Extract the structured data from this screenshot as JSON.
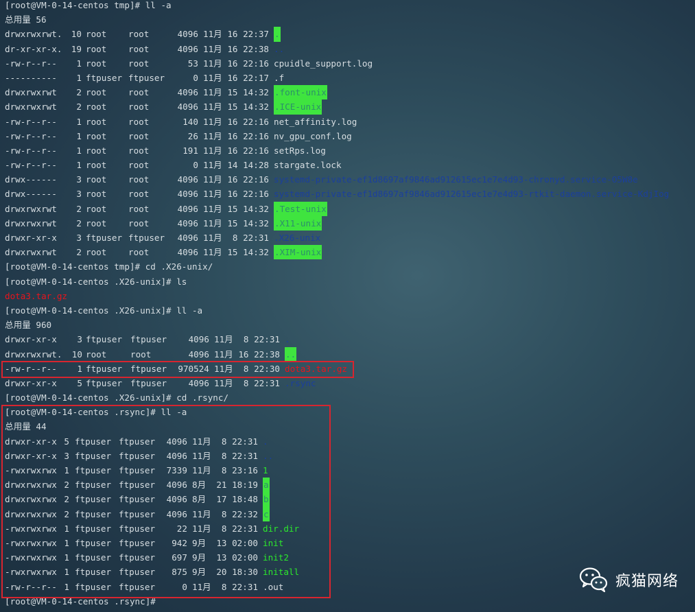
{
  "terminal": {
    "lines": [
      {
        "kind": "prompt",
        "text": "[root@VM-0-14-centos tmp]# ll -a"
      },
      {
        "kind": "text",
        "text": "总用量 56"
      },
      {
        "kind": "entry",
        "perm": "drwxrwxrwt.",
        "links": "10",
        "owner": "root",
        "group": "root",
        "size": "4096",
        "date": "11月 16 22:37",
        "name": ".",
        "style": "hl"
      },
      {
        "kind": "entry",
        "perm": "dr-xr-xr-x.",
        "links": "19",
        "owner": "root",
        "group": "root",
        "size": "4096",
        "date": "11月 16 22:38",
        "name": "..",
        "style": "blue"
      },
      {
        "kind": "entry",
        "perm": "-rw-r--r--",
        "links": "1",
        "owner": "root",
        "group": "root",
        "size": "53",
        "date": "11月 16 22:16",
        "name": "cpuidle_support.log",
        "style": ""
      },
      {
        "kind": "entry",
        "perm": "----------",
        "links": "1",
        "owner": "ftpuser",
        "group": "ftpuser",
        "size": "0",
        "date": "11月 16 22:17",
        "name": ".f",
        "style": ""
      },
      {
        "kind": "entry",
        "perm": "drwxrwxrwt",
        "links": "2",
        "owner": "root",
        "group": "root",
        "size": "4096",
        "date": "11月 15 14:32",
        "name": ".font-unix",
        "style": "hl"
      },
      {
        "kind": "entry",
        "perm": "drwxrwxrwt",
        "links": "2",
        "owner": "root",
        "group": "root",
        "size": "4096",
        "date": "11月 15 14:32",
        "name": ".ICE-unix",
        "style": "hl"
      },
      {
        "kind": "entry",
        "perm": "-rw-r--r--",
        "links": "1",
        "owner": "root",
        "group": "root",
        "size": "140",
        "date": "11月 16 22:16",
        "name": "net_affinity.log",
        "style": ""
      },
      {
        "kind": "entry",
        "perm": "-rw-r--r--",
        "links": "1",
        "owner": "root",
        "group": "root",
        "size": "26",
        "date": "11月 16 22:16",
        "name": "nv_gpu_conf.log",
        "style": ""
      },
      {
        "kind": "entry",
        "perm": "-rw-r--r--",
        "links": "1",
        "owner": "root",
        "group": "root",
        "size": "191",
        "date": "11月 16 22:16",
        "name": "setRps.log",
        "style": ""
      },
      {
        "kind": "entry",
        "perm": "-rw-r--r--",
        "links": "1",
        "owner": "root",
        "group": "root",
        "size": "0",
        "date": "11月 14 14:28",
        "name": "stargate.lock",
        "style": ""
      },
      {
        "kind": "entry",
        "perm": "drwx------",
        "links": "3",
        "owner": "root",
        "group": "root",
        "size": "4096",
        "date": "11月 16 22:16",
        "name": "systemd-private-ef1d8697af9846ad912615ec1e7e4d93-chronyd.service-O5W8e",
        "style": "blue"
      },
      {
        "kind": "entry",
        "perm": "drwx------",
        "links": "3",
        "owner": "root",
        "group": "root",
        "size": "4096",
        "date": "11月 16 22:16",
        "name": "systemd-private-ef1d8697af9846ad912615ec1e7e4d93-rtkit-daemon.service-KdjIog",
        "style": "blue"
      },
      {
        "kind": "entry",
        "perm": "drwxrwxrwt",
        "links": "2",
        "owner": "root",
        "group": "root",
        "size": "4096",
        "date": "11月 15 14:32",
        "name": ".Test-unix",
        "style": "hl"
      },
      {
        "kind": "entry",
        "perm": "drwxrwxrwt",
        "links": "2",
        "owner": "root",
        "group": "root",
        "size": "4096",
        "date": "11月 15 14:32",
        "name": ".X11-unix",
        "style": "hl"
      },
      {
        "kind": "entry",
        "perm": "drwxr-xr-x",
        "links": "3",
        "owner": "ftpuser",
        "group": "ftpuser",
        "size": "4096",
        "date": "11月  8 22:31",
        "name": ".X26-unix",
        "style": "blue"
      },
      {
        "kind": "entry",
        "perm": "drwxrwxrwt",
        "links": "2",
        "owner": "root",
        "group": "root",
        "size": "4096",
        "date": "11月 15 14:32",
        "name": ".XIM-unix",
        "style": "hl"
      },
      {
        "kind": "prompt",
        "text": "[root@VM-0-14-centos tmp]# cd .X26-unix/"
      },
      {
        "kind": "prompt",
        "text": "[root@VM-0-14-centos .X26-unix]# ls"
      },
      {
        "kind": "text",
        "text": "dota3.tar.gz",
        "style": "red"
      },
      {
        "kind": "prompt",
        "text": "[root@VM-0-14-centos .X26-unix]# ll -a"
      },
      {
        "kind": "text",
        "text": "总用量 960"
      },
      {
        "kind": "entry2",
        "perm": "drwxr-xr-x",
        "links": "3",
        "owner": "ftpuser",
        "group": "ftpuser",
        "size": "4096",
        "date": "11月  8 22:31",
        "name": ".",
        "style": "blue"
      },
      {
        "kind": "entry2",
        "perm": "drwxrwxrwt.",
        "links": "10",
        "owner": "root",
        "group": "root",
        "size": "4096",
        "date": "11月 16 22:38",
        "name": "..",
        "style": "hl"
      },
      {
        "kind": "entry2",
        "perm": "-rw-r--r--",
        "links": "1",
        "owner": "ftpuser",
        "group": "ftpuser",
        "size": "970524",
        "date": "11月  8 22:30",
        "name": "dota3.tar.gz",
        "style": "red"
      },
      {
        "kind": "entry2",
        "perm": "drwxr-xr-x",
        "links": "5",
        "owner": "ftpuser",
        "group": "ftpuser",
        "size": "4096",
        "date": "11月  8 22:31",
        "name": ".rsync",
        "style": "blue"
      },
      {
        "kind": "prompt",
        "text": "[root@VM-0-14-centos .X26-unix]# cd .rsync/"
      },
      {
        "kind": "prompt",
        "text": "[root@VM-0-14-centos .rsync]# ll -a"
      },
      {
        "kind": "text",
        "text": "总用量 44"
      },
      {
        "kind": "entry3",
        "perm": "drwxr-xr-x",
        "links": "5",
        "owner": "ftpuser",
        "group": "ftpuser",
        "size": "4096",
        "date": "11月  8 22:31",
        "name": ".",
        "style": "blue"
      },
      {
        "kind": "entry3",
        "perm": "drwxr-xr-x",
        "links": "3",
        "owner": "ftpuser",
        "group": "ftpuser",
        "size": "4096",
        "date": "11月  8 22:31",
        "name": "..",
        "style": "blue"
      },
      {
        "kind": "entry3",
        "perm": "-rwxrwxrwx",
        "links": "1",
        "owner": "ftpuser",
        "group": "ftpuser",
        "size": "7339",
        "date": "11月  8 23:16",
        "name": "1",
        "style": "green"
      },
      {
        "kind": "entry3",
        "perm": "drwxrwxrwx",
        "links": "2",
        "owner": "ftpuser",
        "group": "ftpuser",
        "size": "4096",
        "date": "8月  21 18:19",
        "name": "a",
        "style": "hl"
      },
      {
        "kind": "entry3",
        "perm": "drwxrwxrwx",
        "links": "2",
        "owner": "ftpuser",
        "group": "ftpuser",
        "size": "4096",
        "date": "8月  17 18:48",
        "name": "b",
        "style": "hl"
      },
      {
        "kind": "entry3",
        "perm": "drwxrwxrwx",
        "links": "2",
        "owner": "ftpuser",
        "group": "ftpuser",
        "size": "4096",
        "date": "11月  8 22:32",
        "name": "c",
        "style": "hl"
      },
      {
        "kind": "entry3",
        "perm": "-rwxrwxrwx",
        "links": "1",
        "owner": "ftpuser",
        "group": "ftpuser",
        "size": "22",
        "date": "11月  8 22:31",
        "name": "dir.dir",
        "style": "green"
      },
      {
        "kind": "entry3",
        "perm": "-rwxrwxrwx",
        "links": "1",
        "owner": "ftpuser",
        "group": "ftpuser",
        "size": "942",
        "date": "9月  13 02:00",
        "name": "init",
        "style": "green"
      },
      {
        "kind": "entry3",
        "perm": "-rwxrwxrwx",
        "links": "1",
        "owner": "ftpuser",
        "group": "ftpuser",
        "size": "697",
        "date": "9月  13 02:00",
        "name": "init2",
        "style": "green"
      },
      {
        "kind": "entry3",
        "perm": "-rwxrwxrwx",
        "links": "1",
        "owner": "ftpuser",
        "group": "ftpuser",
        "size": "875",
        "date": "9月  20 18:30",
        "name": "initall",
        "style": "green"
      },
      {
        "kind": "entry3",
        "perm": "-rw-r--r--",
        "links": "1",
        "owner": "ftpuser",
        "group": "ftpuser",
        "size": "0",
        "date": "11月  8 22:31",
        "name": ".out",
        "style": ""
      },
      {
        "kind": "prompt",
        "text": "[root@VM-0-14-centos .rsync]#"
      }
    ]
  },
  "watermark": {
    "text": "疯猫网络",
    "icon": "wechat-icon"
  },
  "colors": {
    "highlight": "#3fe43f",
    "directory_blue": "#1b3f9c",
    "archive_red": "#e8141c",
    "executable_green": "#2ce82c",
    "annotation_box": "#d8252f"
  }
}
